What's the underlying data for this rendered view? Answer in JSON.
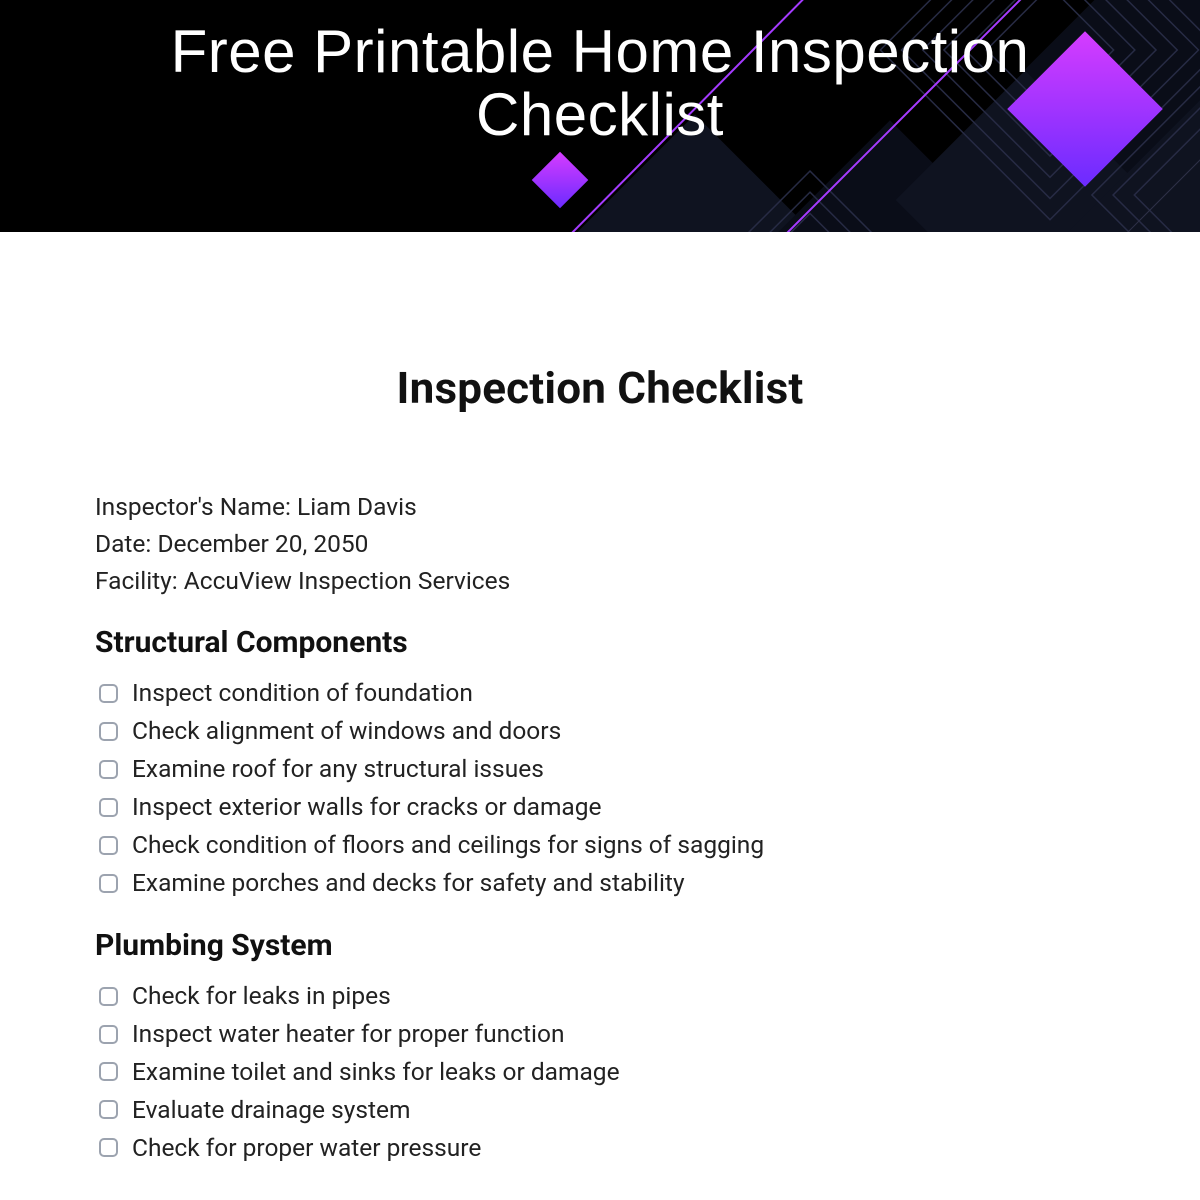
{
  "banner": {
    "title": "Free Printable Home Inspection Checklist"
  },
  "page": {
    "title": "Inspection Checklist",
    "meta": {
      "inspector_label": "Inspector's Name:",
      "inspector_value": "Liam Davis",
      "date_label": "Date:",
      "date_value": "December 20, 2050",
      "facility_label": "Facility:",
      "facility_value": "AccuView Inspection Services"
    },
    "sections": [
      {
        "heading": "Structural Components",
        "items": [
          "Inspect condition of foundation",
          "Check alignment of windows and doors",
          "Examine roof for any structural issues",
          "Inspect exterior walls for cracks or damage",
          "Check condition of floors and ceilings for signs of sagging",
          "Examine porches and decks for safety and stability"
        ]
      },
      {
        "heading": "Plumbing System",
        "items": [
          "Check for leaks in pipes",
          "Inspect water heater for proper function",
          "Examine toilet and sinks for leaks or damage",
          "Evaluate drainage system",
          "Check for proper water pressure"
        ]
      }
    ]
  }
}
